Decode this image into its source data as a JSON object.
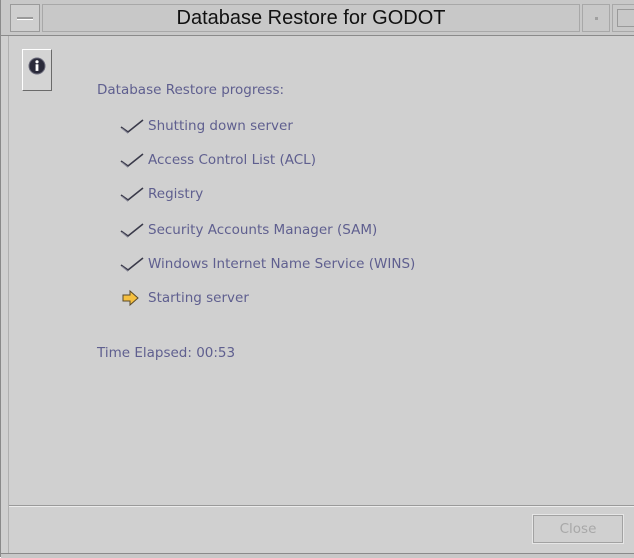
{
  "window": {
    "title": "Database Restore for GODOT"
  },
  "progress": {
    "heading": "Database Restore progress:",
    "steps": [
      {
        "label": "Shutting down server",
        "status": "done",
        "icon": "checkmark-icon"
      },
      {
        "label": "Access Control List (ACL)",
        "status": "done",
        "icon": "checkmark-icon"
      },
      {
        "label": "Registry",
        "status": "done",
        "icon": "checkmark-icon"
      },
      {
        "label": "Security Accounts Manager (SAM)",
        "status": "done",
        "icon": "checkmark-icon"
      },
      {
        "label": "Windows Internet Name Service (WINS)",
        "status": "done",
        "icon": "checkmark-icon"
      },
      {
        "label": "Starting server",
        "status": "in-progress",
        "icon": "arrow-right-icon"
      }
    ],
    "time_elapsed": "Time Elapsed: 00:53"
  },
  "buttons": {
    "close_label": "Close",
    "close_enabled": false
  },
  "colors": {
    "text": "#5f5f8f",
    "background": "#d0d0d0",
    "arrow": "#f5c040"
  },
  "icons": {
    "info": "info-icon",
    "done": "checkmark-icon",
    "current": "arrow-right-icon"
  }
}
